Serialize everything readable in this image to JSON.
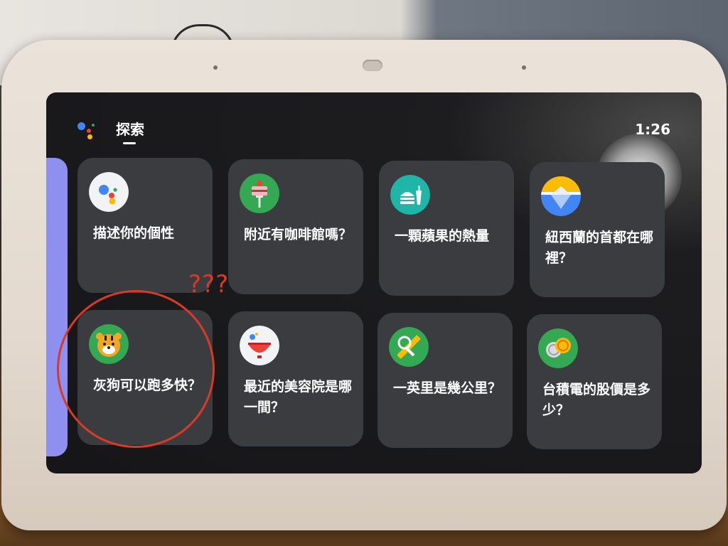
{
  "header": {
    "title": "探索",
    "time": "1:26",
    "assistant_icon": "google-assistant-icon"
  },
  "cards": [
    {
      "label": "描述你的個性",
      "icon": "google-assistant-icon"
    },
    {
      "label": "附近有咖啡館嗎？",
      "icon": "cake-fork-icon"
    },
    {
      "label": "一顆蘋果的熱量",
      "icon": "food-burger-drink-icon"
    },
    {
      "label": "紐西蘭的首都在哪裡？",
      "icon": "iceberg-icon"
    },
    {
      "label": "灰狗可以跑多快？",
      "icon": "tiger-icon"
    },
    {
      "label": "最近的美容院是哪一間？",
      "icon": "bowl-icon"
    },
    {
      "label": "一英里是幾公里？",
      "icon": "ruler-magnifier-icon"
    },
    {
      "label": "台積電的股價是多少？",
      "icon": "coins-icon"
    }
  ],
  "annotation": {
    "text": "???",
    "color": "#d83a28"
  },
  "colors": {
    "card_bg": "#3b3c40",
    "side_tab": "#8f8ff0",
    "screen_bg": "#161618"
  }
}
